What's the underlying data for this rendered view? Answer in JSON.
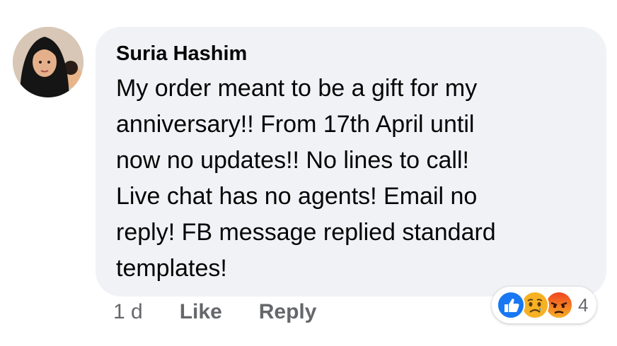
{
  "comment": {
    "author": "Suria Hashim",
    "text": "My order meant to be a gift for my\nanniversary!! From 17th April until\nnow no updates!! No lines to call!\nLive chat has no agents! Email no\nreply! FB message replied standard\ntemplates!",
    "timestamp": "1 d",
    "like_label": "Like",
    "reply_label": "Reply",
    "reactions": {
      "icons": [
        "like-icon",
        "sad-icon",
        "angry-icon"
      ],
      "count": "4"
    }
  },
  "colors": {
    "bubble": "#f0f2f5",
    "text": "#050505",
    "secondary": "#65676b",
    "like": "#1877f2",
    "sad": "#f7b125",
    "angry": "#e9710f"
  }
}
